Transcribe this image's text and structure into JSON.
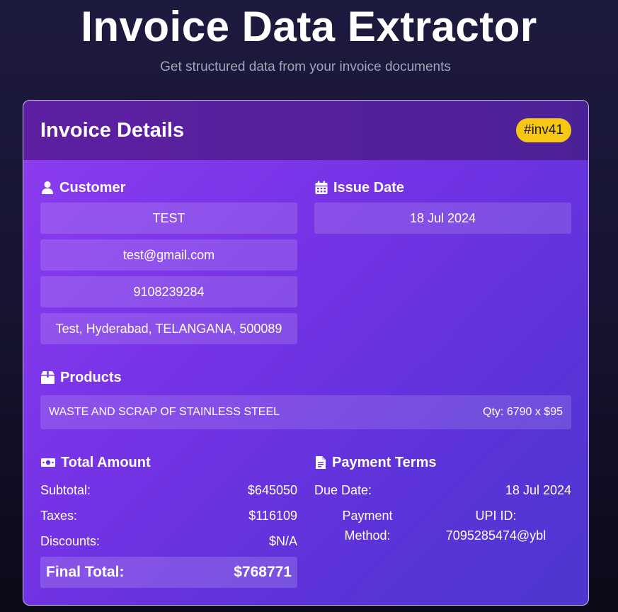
{
  "page": {
    "title": "Invoice Data Extractor",
    "subtitle": "Get structured data from your invoice documents"
  },
  "card": {
    "title": "Invoice Details",
    "badge": "#inv41"
  },
  "customer": {
    "heading": "Customer",
    "icon": "user-icon",
    "name": "TEST",
    "email": "test@gmail.com",
    "phone": "9108239284",
    "address": "Test, Hyderabad, TELANGANA, 500089"
  },
  "issue_date": {
    "heading": "Issue Date",
    "icon": "calendar-icon",
    "value": "18 Jul 2024"
  },
  "products": {
    "heading": "Products",
    "icon": "box-icon",
    "items": [
      {
        "name": "WASTE AND SCRAP OF STAINLESS STEEL",
        "qty": "Qty: 6790 x $95"
      }
    ]
  },
  "total_amount": {
    "heading": "Total Amount",
    "icon": "money-icon",
    "subtotal_label": "Subtotal:",
    "subtotal_value": "$645050",
    "taxes_label": "Taxes:",
    "taxes_value": "$116109",
    "discounts_label": "Discounts:",
    "discounts_value": "$N/A",
    "final_label": "Final Total:",
    "final_value": "$768771"
  },
  "payment_terms": {
    "heading": "Payment Terms",
    "icon": "document-icon",
    "due_label": "Due Date:",
    "due_value": "18 Jul 2024",
    "method_label_1": "Payment",
    "method_label_2": "Method:",
    "method_value_1": "UPI ID:",
    "method_value_2": "7095285474@ybl"
  },
  "colors": {
    "badge_bg": "#f6c813",
    "header_bg": "#5e1fa3",
    "card_gradient_start": "#8f3df0",
    "card_gradient_end": "#4d36cf"
  }
}
